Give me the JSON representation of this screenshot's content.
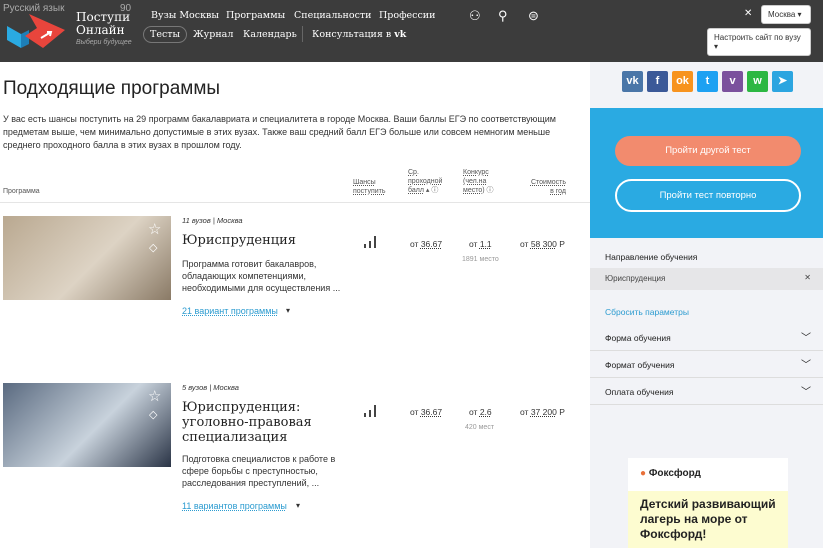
{
  "header": {
    "lang_label": "Русский язык",
    "lang_value": "90",
    "brand_line1": "Поступи",
    "brand_line2": "Онлайн",
    "slogan": "Выбери будущее",
    "nav_top": [
      "Вузы Москвы",
      "Программы",
      "Специальности",
      "Профессии"
    ],
    "nav_bottom": [
      "Тесты",
      "Журнал",
      "Календарь"
    ],
    "consult": "Консультация в",
    "city": "Москва ▾",
    "customize": "Настроить сайт по вузу ▾",
    "close": "✕"
  },
  "main": {
    "title": "Подходящие программы",
    "intro": "У вас есть шансы поступить на 29 программ бакалавриата и специалитета в городе Москва. Ваши баллы ЕГЭ по соответствующим предметам выше, чем минимально допустимые в этих вузах. Также ваш средний балл ЕГЭ больше или совсем немногим меньше среднего проходного балла в этих вузах в прошлом году.",
    "columns": {
      "program": "Программа",
      "chances": [
        "Шансы",
        "поступить"
      ],
      "score": [
        "Ср.",
        "проходной",
        "балл"
      ],
      "competition": [
        "Конкурс",
        "(чел.на",
        "место)"
      ],
      "cost": [
        "Стоимость",
        "в год"
      ]
    },
    "programs": [
      {
        "unis": "11 вузов",
        "city": "Москва",
        "title": "Юриспруденция",
        "desc": "Программа готовит бакалавров, обладающих компетенциями, необходимыми  для осуществления ...",
        "variants": "21 вариант программы",
        "score_prefix": "от",
        "score": "36.67",
        "comp_prefix": "от",
        "comp": "1.1",
        "place": "1891 место",
        "cost_prefix": "от",
        "cost": "58 300",
        "currency": "Р"
      },
      {
        "unis": "5 вузов",
        "city": "Москва",
        "title": "Юриспруденция: уголовно-правовая специализация",
        "desc": "Подготовка специалистов к работе в сфере борьбы с преступностью, расследования преступлений, ...",
        "variants": "11 вариантов программы",
        "score_prefix": "от",
        "score": "36.67",
        "comp_prefix": "от",
        "comp": "2.6",
        "place": "420 мест",
        "cost_prefix": "от",
        "cost": "37 200",
        "currency": "Р"
      }
    ]
  },
  "sidebar": {
    "social": [
      "vk",
      "f",
      "ok",
      "tw",
      "vb",
      "wa",
      "tg"
    ],
    "btn_other": "Пройти другой тест",
    "btn_repeat": "Пройти тест повторно",
    "direction_label": "Направление обучения",
    "direction_value": "Юриспруденция",
    "reset": "Сбросить параметры",
    "filters": [
      "Форма обучения",
      "Формат обучения",
      "Оплата обучения"
    ],
    "ad": {
      "brand": "Фоксфорд",
      "text": "Детский развивающий лагерь на море от Фоксфорд!"
    }
  }
}
